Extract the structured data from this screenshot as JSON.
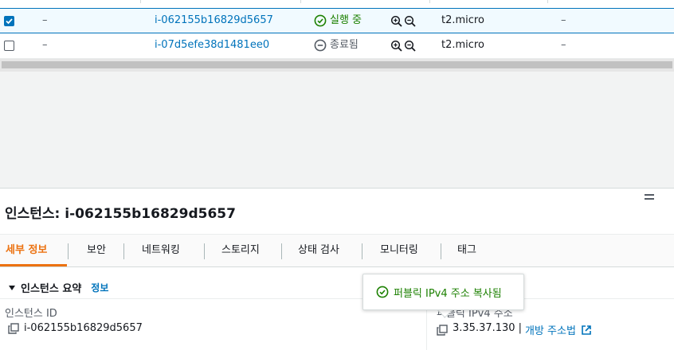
{
  "table": {
    "rows": [
      {
        "selected": true,
        "name": "–",
        "instance_id": "i-062155b16829d5657",
        "state": "실행 중",
        "state_kind": "running",
        "type": "t2.micro",
        "last": "–"
      },
      {
        "selected": false,
        "name": "–",
        "instance_id": "i-07d5efe38d1481ee0",
        "state": "종료됨",
        "state_kind": "terminated",
        "type": "t2.micro",
        "last": "–"
      }
    ]
  },
  "details": {
    "title": "인스턴스: i-062155b16829d5657",
    "tabs": [
      "세부 정보",
      "보안",
      "네트워킹",
      "스토리지",
      "상태 검사",
      "모니터링",
      "태그"
    ],
    "active_tab": "세부 정보",
    "section_title": "인스턴스 요약",
    "section_info_link": "정보",
    "instance_id_label": "인스턴스 ID",
    "instance_id_value": "i-062155b16829d5657",
    "public_ip_label": "퍼블릭 IPv4 주소",
    "public_ip_value": "3.35.37.130",
    "public_ip_separator": "|",
    "open_address_link": "개방 주소법"
  },
  "toast": {
    "message": "퍼블릭 IPv4 주소 복사됨"
  },
  "colors": {
    "link": "#0073bb",
    "running": "#1d8102",
    "accent": "#ec7211",
    "muted": "#545b64"
  }
}
